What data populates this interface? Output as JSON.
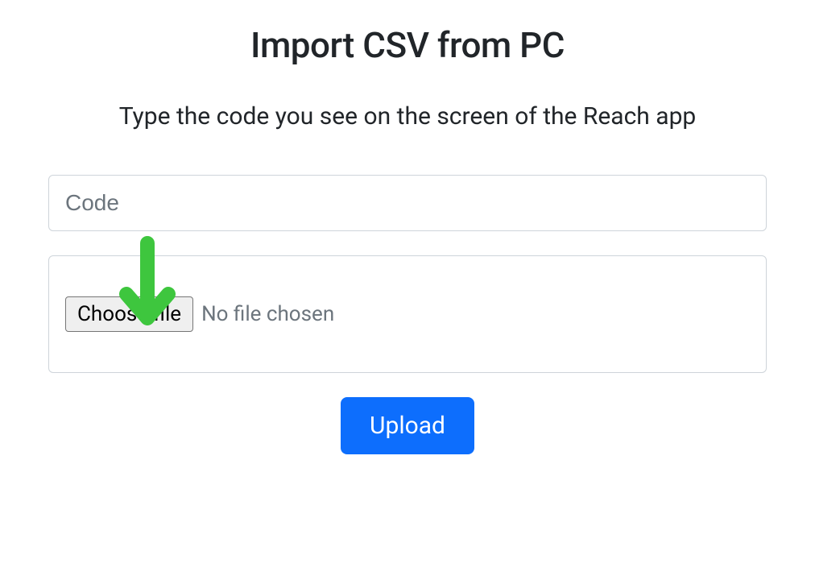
{
  "heading": "Import CSV from PC",
  "subtitle": "Type the code you see on the screen of the Reach app",
  "code_input": {
    "placeholder": "Code",
    "value": ""
  },
  "file_picker": {
    "button_label": "Choose file",
    "status": "No file chosen"
  },
  "upload_button_label": "Upload",
  "colors": {
    "primary": "#0d6efd",
    "arrow": "#3ec63e"
  }
}
